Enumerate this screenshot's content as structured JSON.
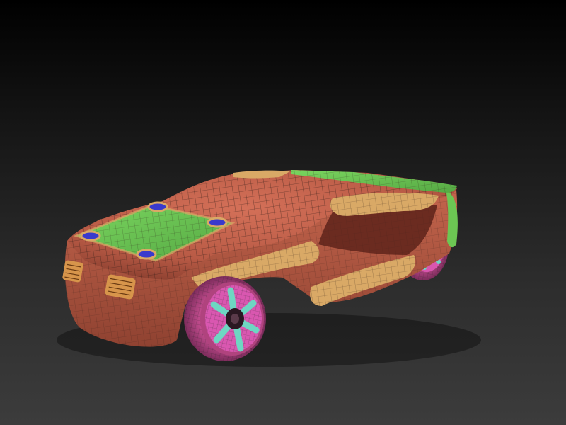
{
  "viewport": {
    "background_top": "#000000",
    "background_bottom": "#3c3c3c"
  },
  "model": {
    "subject": "car-concept-3d-model",
    "colors": {
      "body": "#c0644e",
      "body_shade": "#8a3e30",
      "accent_panel": "#d9a966",
      "roof_panel": "#6cc653",
      "roof_panel_dark": "#4f9a3c",
      "marker": "#3a3acc",
      "wheel_tire": "#c04c8c",
      "wheel_rim": "#d957b0",
      "wheel_spoke": "#6ed6c2",
      "light_block": "#d7954b",
      "wire": "#2a1a14"
    }
  }
}
